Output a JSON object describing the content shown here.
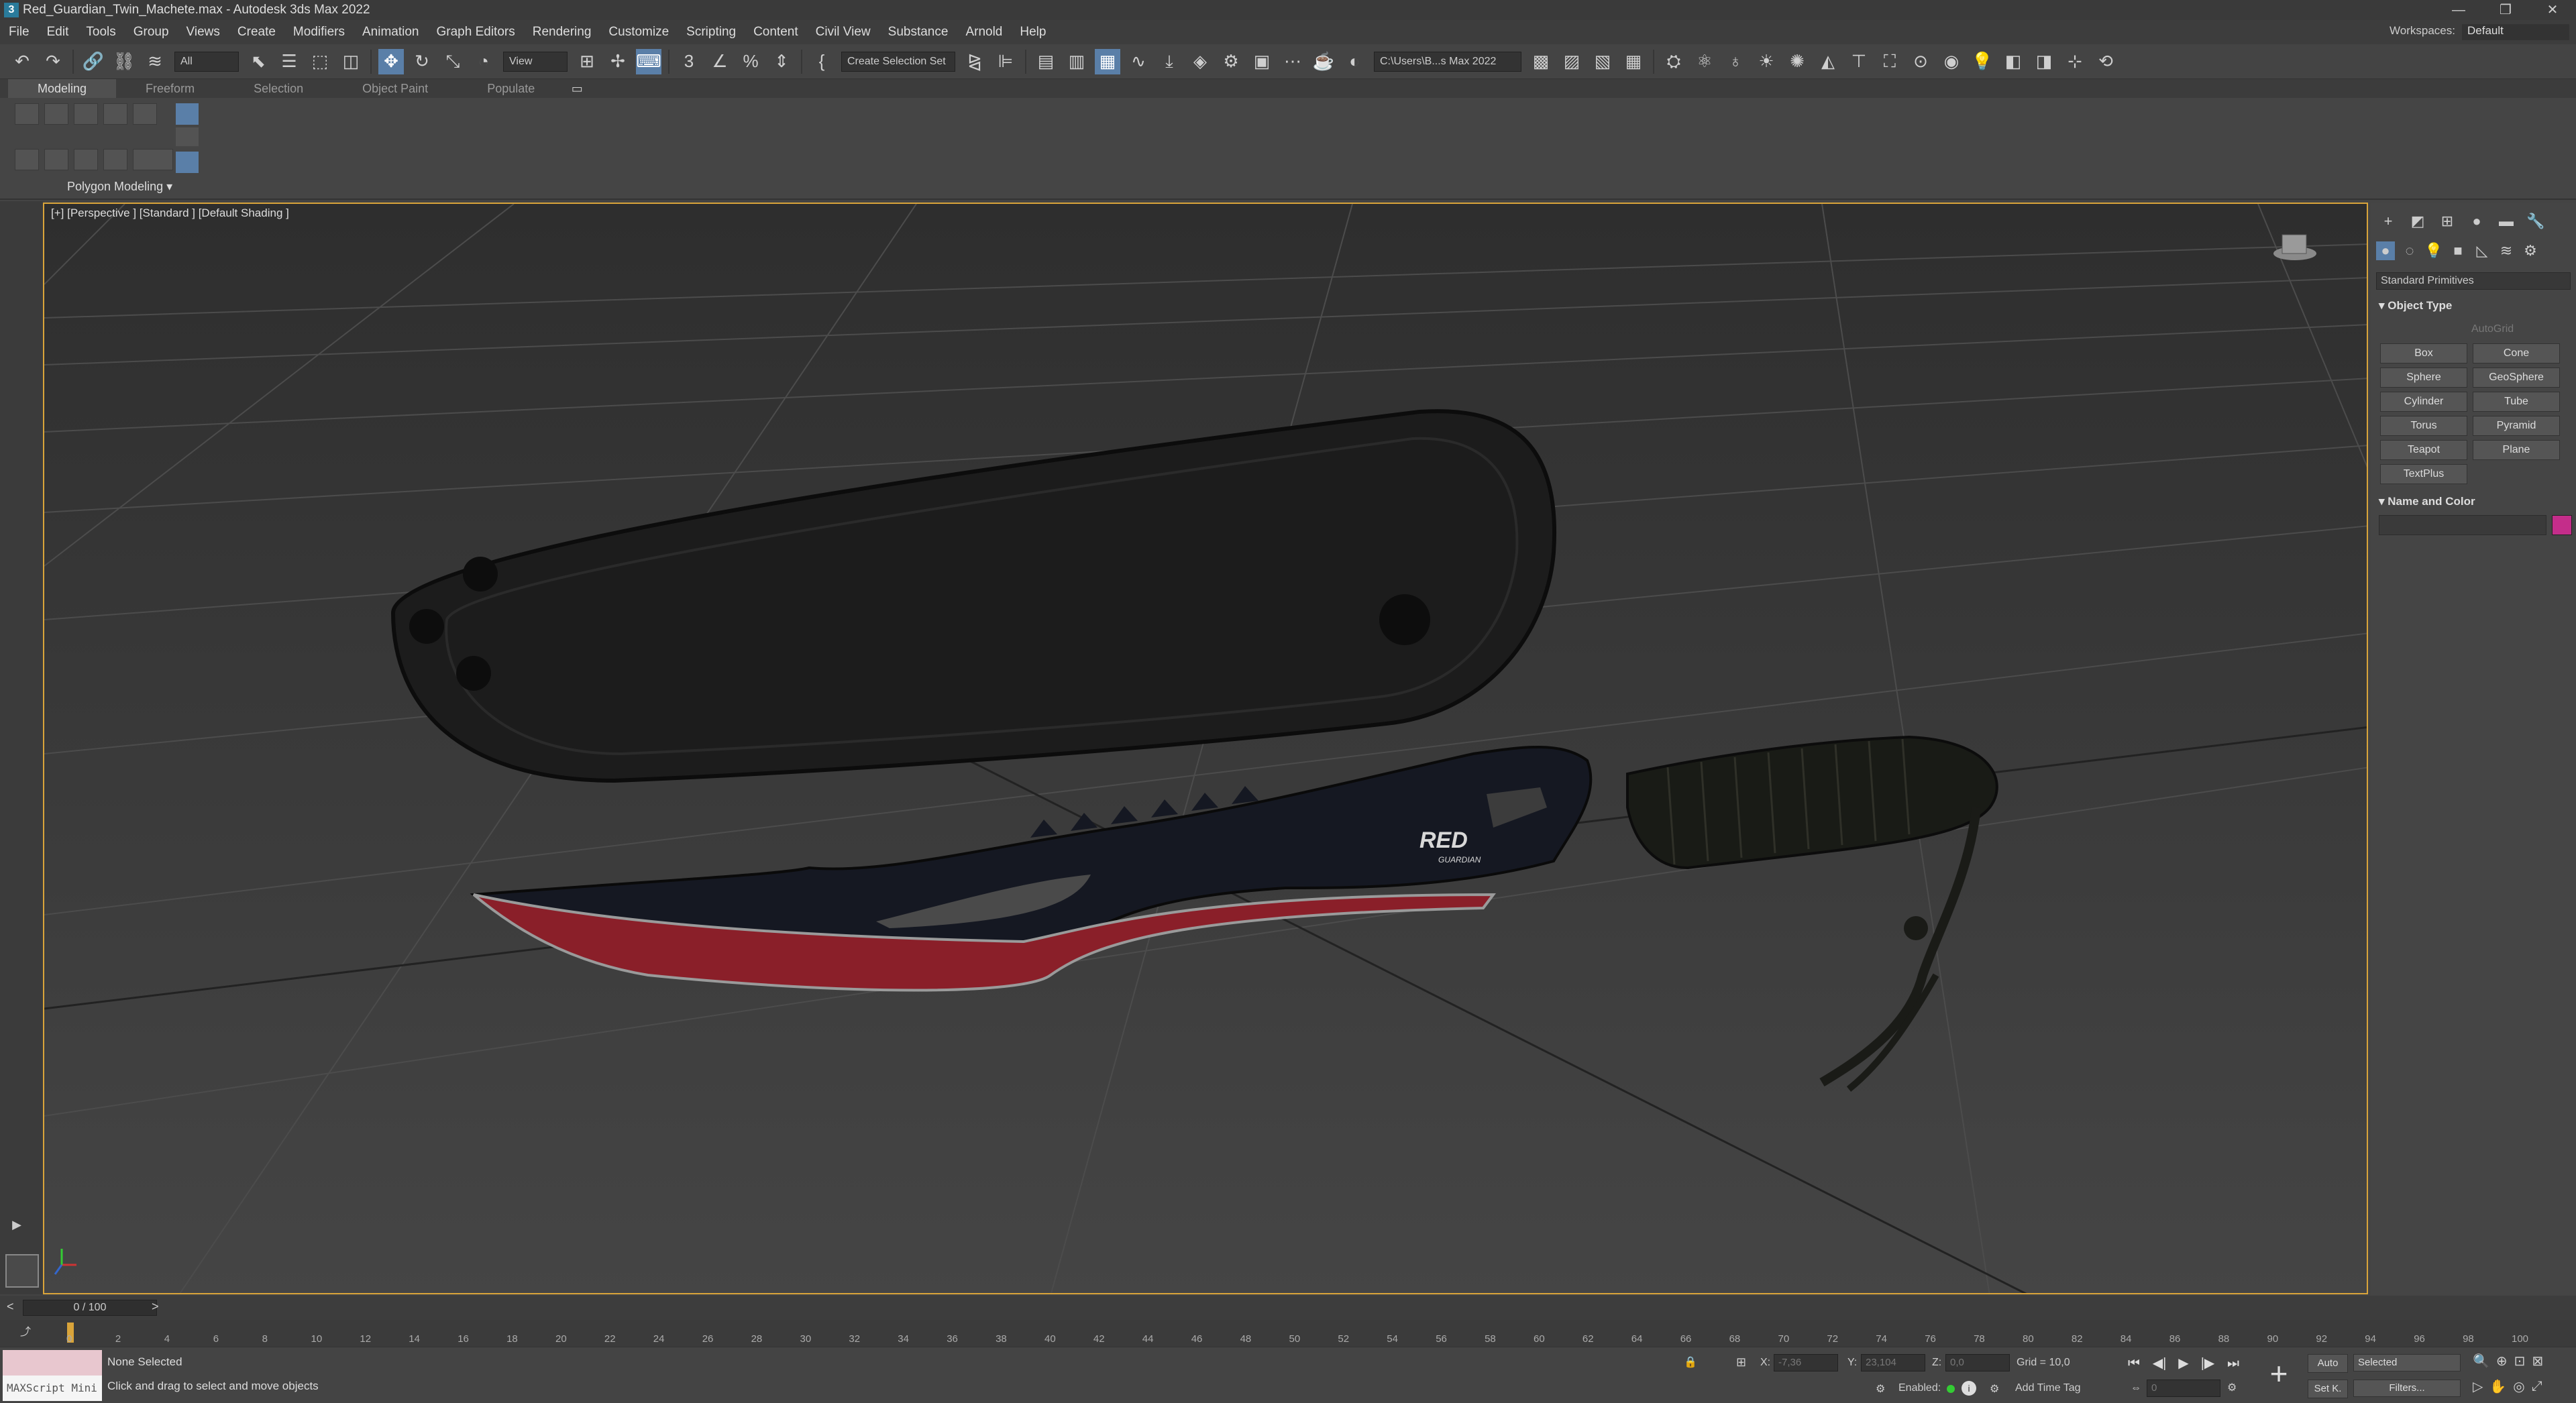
{
  "window": {
    "title": "Red_Guardian_Twin_Machete.max - Autodesk 3ds Max 2022",
    "app_icon": "3",
    "min": "—",
    "max": "❐",
    "close": "✕"
  },
  "menu": [
    "File",
    "Edit",
    "Tools",
    "Group",
    "Views",
    "Create",
    "Modifiers",
    "Animation",
    "Graph Editors",
    "Rendering",
    "Customize",
    "Scripting",
    "Content",
    "Civil View",
    "Substance",
    "Arnold",
    "Help"
  ],
  "workspace": {
    "label": "Workspaces:",
    "value": "Default"
  },
  "toolbar": {
    "filter": "All",
    "refcoord": "View",
    "selection_set": "Create Selection Set",
    "project_path": "C:\\Users\\B...s Max 2022"
  },
  "ribbon": {
    "tabs": [
      "Modeling",
      "Freeform",
      "Selection",
      "Object Paint",
      "Populate"
    ],
    "active": "Modeling",
    "panel": "Polygon Modeling ▾"
  },
  "viewport": {
    "label": "[+] [Perspective ] [Standard ] [Default Shading ]",
    "logo_text": "RED",
    "logo_sub": "GUARDIAN"
  },
  "command_panel": {
    "dropdown": "Standard Primitives",
    "object_type_title": "Object Type",
    "autogrid": "AutoGrid",
    "buttons": [
      "Box",
      "Cone",
      "Sphere",
      "GeoSphere",
      "Cylinder",
      "Tube",
      "Torus",
      "Pyramid",
      "Teapot",
      "Plane",
      "TextPlus"
    ],
    "name_color_title": "Name and Color",
    "color": "#c42d8a"
  },
  "timeline": {
    "frame": "0 / 100",
    "ticks": [
      "0",
      "2",
      "4",
      "6",
      "8",
      "10",
      "12",
      "14",
      "16",
      "18",
      "20",
      "22",
      "24",
      "26",
      "28",
      "30",
      "32",
      "34",
      "36",
      "38",
      "40",
      "42",
      "44",
      "46",
      "48",
      "50",
      "52",
      "54",
      "56",
      "58",
      "60",
      "62",
      "64",
      "66",
      "68",
      "70",
      "72",
      "74",
      "76",
      "78",
      "80",
      "82",
      "84",
      "86",
      "88",
      "90",
      "92",
      "94",
      "96",
      "98",
      "100"
    ]
  },
  "status": {
    "maxscript": "MAXScript Mini",
    "selection": "None Selected",
    "prompt": "Click and drag to select and move objects",
    "x_label": "X:",
    "x_val": "-7,36",
    "y_label": "Y:",
    "y_val": "23,104",
    "z_label": "Z:",
    "z_val": "0,0",
    "grid": "Grid = 10,0",
    "enabled": "Enabled:",
    "add_time_tag": "Add Time Tag",
    "auto": "Auto",
    "selected": "Selected",
    "setk": "Set K.",
    "filters": "Filters...",
    "frame_field": "0"
  }
}
